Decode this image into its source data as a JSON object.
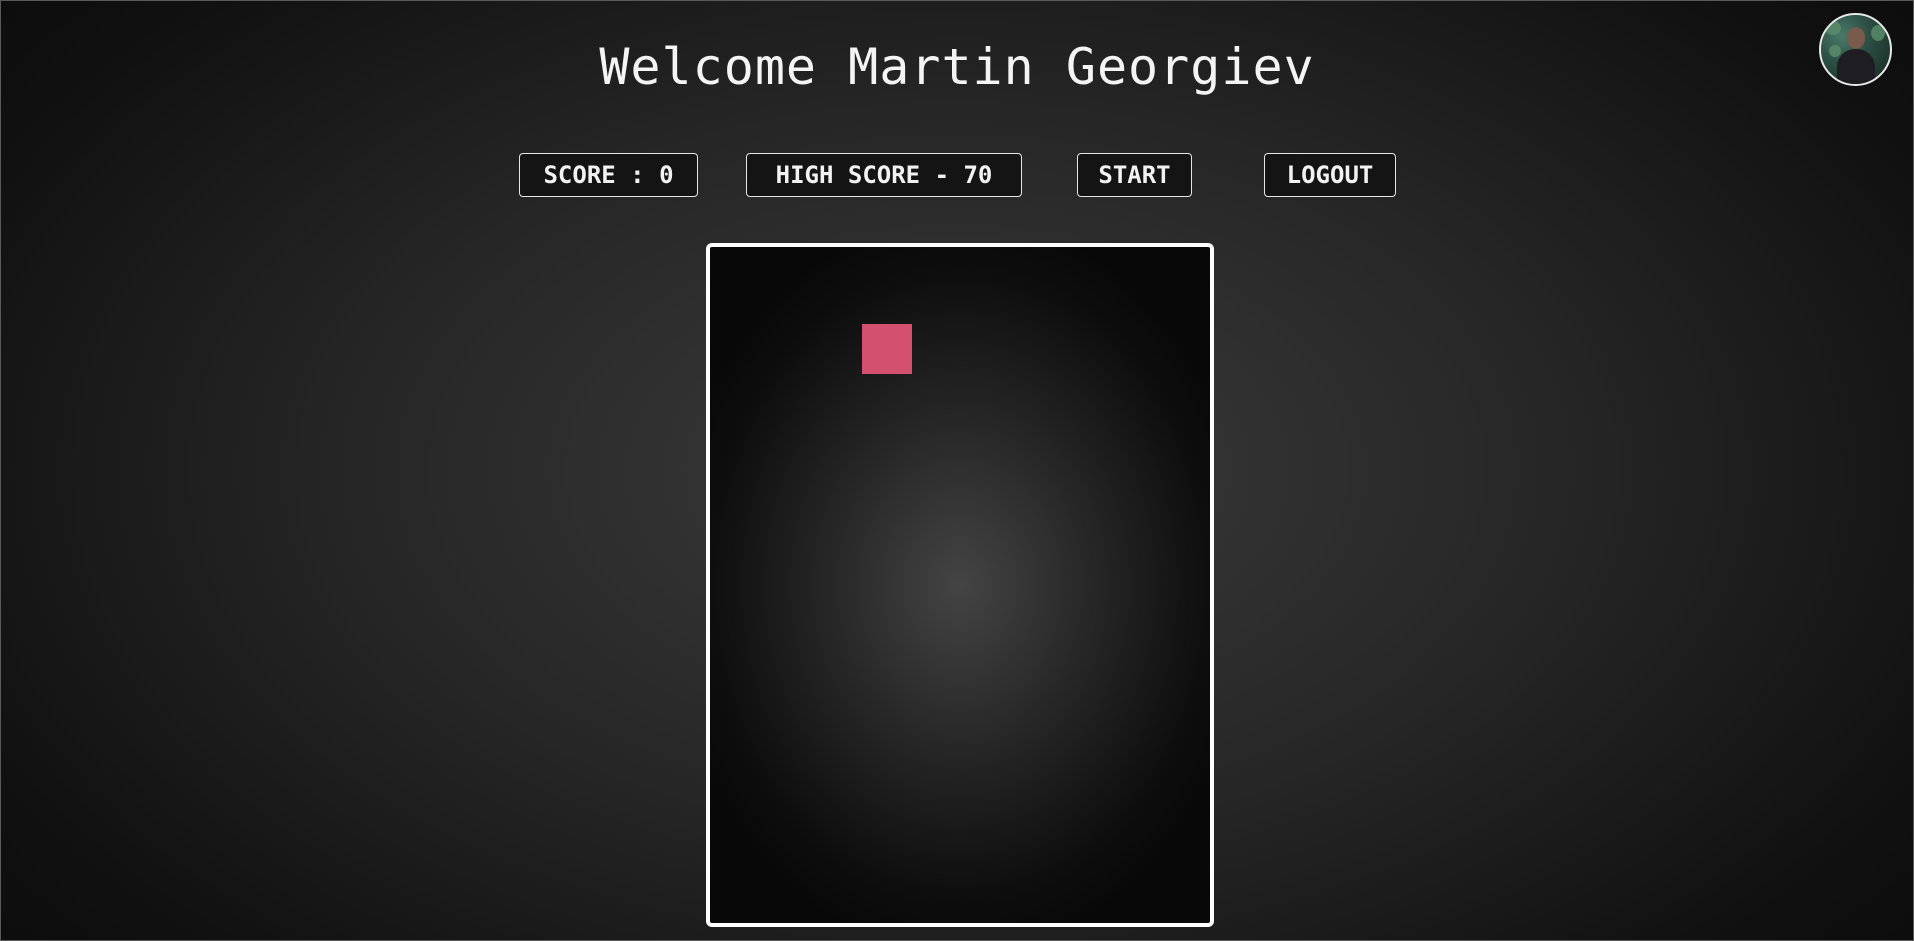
{
  "header": {
    "title": "Welcome Martin Georgiev"
  },
  "user": {
    "avatar_icon": "user-avatar-photo"
  },
  "toolbar": {
    "score_label": "SCORE : 0",
    "high_score_label": "HIGH SCORE - 70",
    "start_label": "START",
    "logout_label": "LOGOUT"
  },
  "game": {
    "piece_color": "#d4506f",
    "border_color": "#ffffff"
  }
}
